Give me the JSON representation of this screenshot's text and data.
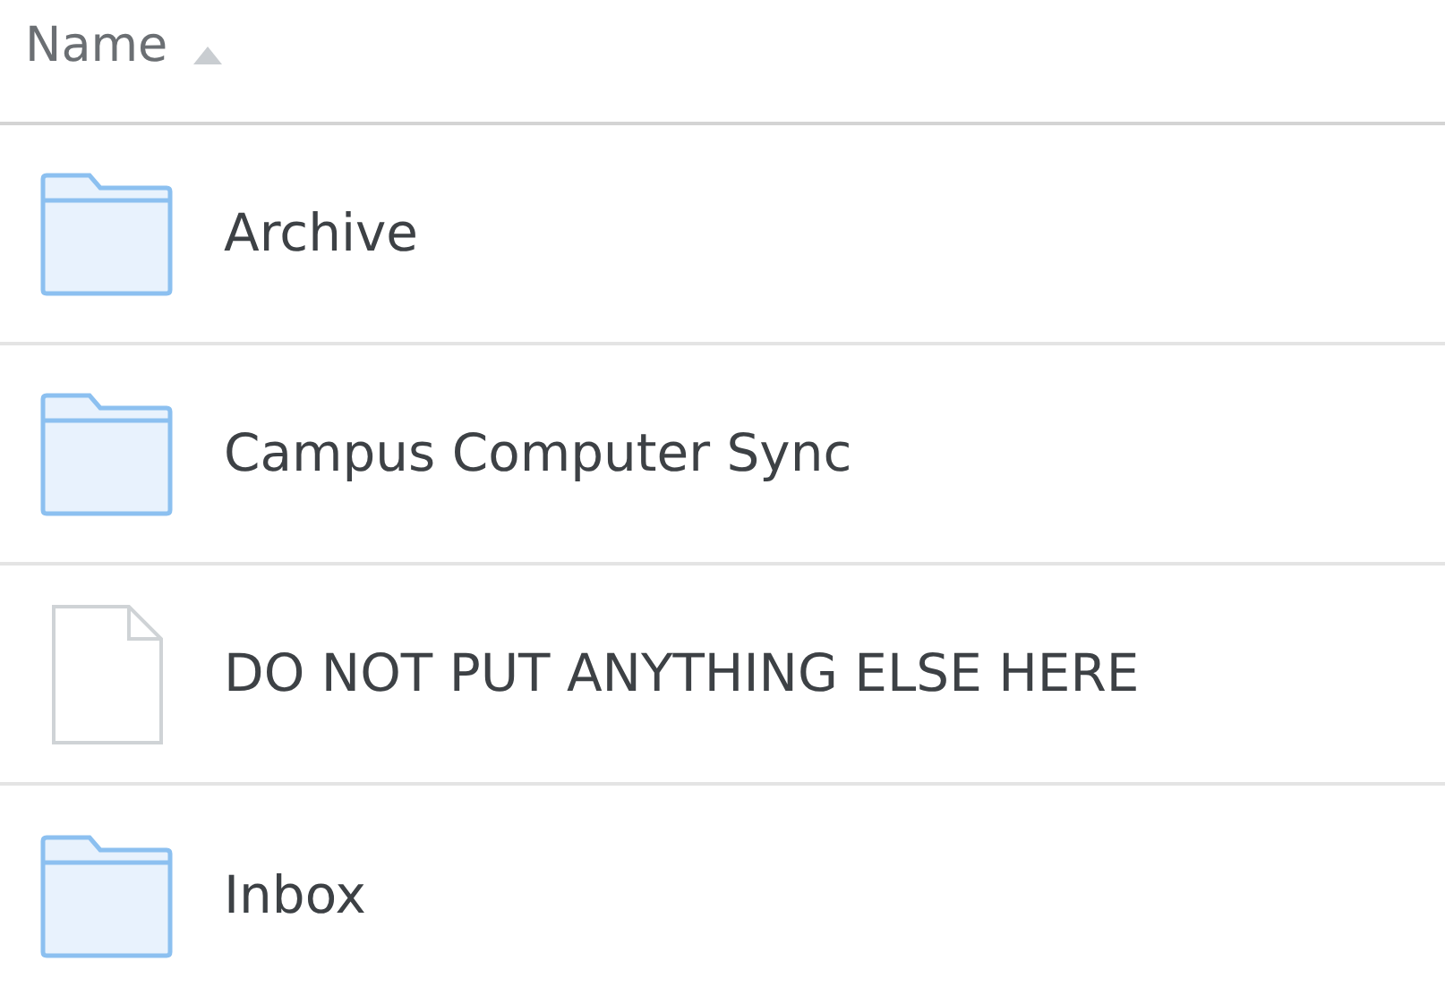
{
  "header": {
    "label": "Name",
    "ascending": true
  },
  "items": [
    {
      "name": "Archive",
      "kind": "folder"
    },
    {
      "name": "Campus Computer Sync",
      "kind": "folder"
    },
    {
      "name": "DO NOT PUT ANYTHING ELSE HERE",
      "kind": "file"
    },
    {
      "name": "Inbox",
      "kind": "folder"
    }
  ]
}
